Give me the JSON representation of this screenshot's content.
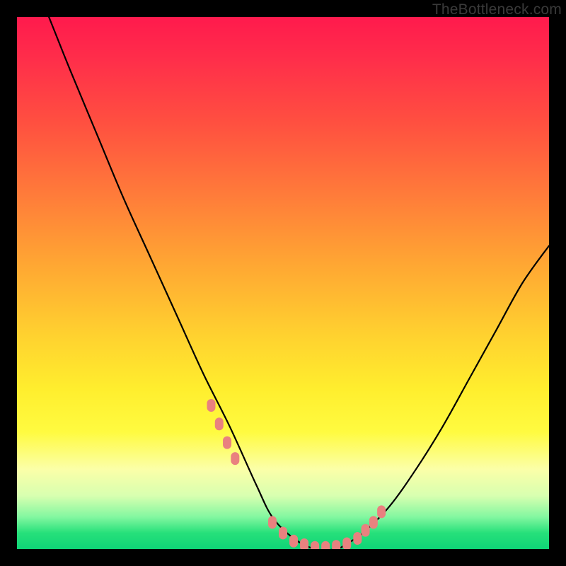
{
  "watermark": "TheBottleneck.com",
  "chart_data": {
    "type": "line",
    "title": "",
    "xlabel": "",
    "ylabel": "",
    "xlim": [
      0,
      100
    ],
    "ylim": [
      0,
      100
    ],
    "grid": false,
    "legend": false,
    "series": [
      {
        "name": "curve",
        "x": [
          6,
          10,
          15,
          20,
          25,
          30,
          35,
          40,
          45,
          48,
          52,
          56,
          60,
          62,
          65,
          70,
          75,
          80,
          85,
          90,
          95,
          100
        ],
        "y": [
          100,
          90,
          78,
          66,
          55,
          44,
          33,
          23,
          12,
          6,
          2,
          0,
          0,
          1,
          3,
          8,
          15,
          23,
          32,
          41,
          50,
          57
        ]
      }
    ],
    "markers": [
      {
        "name": "highlight-dots",
        "color": "#e9817f",
        "x": [
          36.5,
          38,
          39.5,
          41,
          48,
          50,
          52,
          54,
          56,
          58,
          60,
          62,
          64,
          65.5,
          67,
          68.5
        ],
        "y": [
          27,
          23.5,
          20,
          17,
          5,
          3,
          1.5,
          0.8,
          0.3,
          0.3,
          0.5,
          1,
          2,
          3.5,
          5,
          7
        ]
      }
    ],
    "bands": [
      {
        "name": "pale-yellow",
        "y0": 78,
        "y1": 85,
        "color": "#fbffa8"
      },
      {
        "name": "pale-green",
        "y0": 90,
        "y1": 94,
        "color": "#d8ffb0"
      },
      {
        "name": "green",
        "y0": 96,
        "y1": 100,
        "color": "#26e07a"
      }
    ]
  }
}
